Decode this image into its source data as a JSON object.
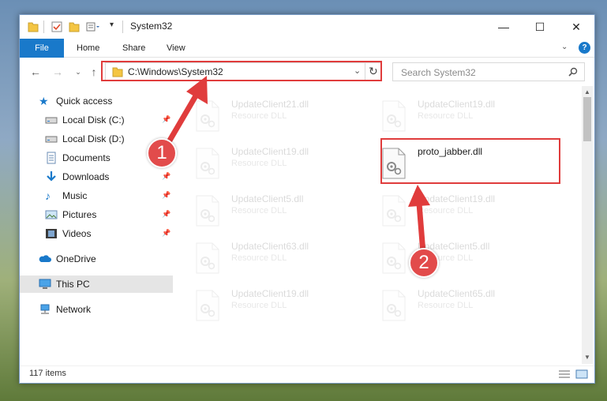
{
  "window": {
    "title": "System32",
    "controls": {
      "minimize": "—",
      "maximize": "☐",
      "close": "✕"
    }
  },
  "ribbon": {
    "tabs": [
      {
        "label": "File",
        "active": true
      },
      {
        "label": "Home"
      },
      {
        "label": "Share"
      },
      {
        "label": "View"
      }
    ]
  },
  "address": {
    "path": "C:\\Windows\\System32",
    "search_placeholder": "Search System32"
  },
  "sidebar": {
    "items": [
      {
        "label": "Quick access",
        "icon": "star-icon",
        "pinned": false
      },
      {
        "label": "Local Disk (C:)",
        "icon": "drive-icon",
        "pinned": true
      },
      {
        "label": "Local Disk (D:)",
        "icon": "drive-icon",
        "pinned": false
      },
      {
        "label": "Documents",
        "icon": "documents-icon",
        "pinned": true
      },
      {
        "label": "Downloads",
        "icon": "download-icon",
        "pinned": true
      },
      {
        "label": "Music",
        "icon": "music-icon",
        "pinned": true
      },
      {
        "label": "Pictures",
        "icon": "pictures-icon",
        "pinned": true
      },
      {
        "label": "Videos",
        "icon": "videos-icon",
        "pinned": true
      },
      {
        "label": "OneDrive",
        "icon": "cloud-icon",
        "pinned": false
      },
      {
        "label": "This PC",
        "icon": "computer-icon",
        "pinned": false
      },
      {
        "label": "Network",
        "icon": "network-icon",
        "pinned": false
      }
    ]
  },
  "files": [
    {
      "name": "UpdateClient21.dll",
      "type": "Resource DLL",
      "faded": true
    },
    {
      "name": "UpdateClient19.dll",
      "type": "Resource DLL",
      "faded": true
    },
    {
      "name": "UpdateClient19.dll",
      "type": "Resource DLL",
      "faded": true
    },
    {
      "name": "proto_jabber.dll",
      "type": "",
      "faded": false
    },
    {
      "name": "UpdateClient5.dll",
      "type": "Resource DLL",
      "faded": true
    },
    {
      "name": "UpdateClient19.dll",
      "type": "Resource DLL",
      "faded": true
    },
    {
      "name": "UpdateClient63.dll",
      "type": "Resource DLL",
      "faded": true
    },
    {
      "name": "UpdateClient5.dll",
      "type": "Resource DLL",
      "faded": true
    },
    {
      "name": "UpdateClient19.dll",
      "type": "Resource DLL",
      "faded": true
    },
    {
      "name": "UpdateClient65.dll",
      "type": "Resource DLL",
      "faded": true
    }
  ],
  "status": {
    "item_count": "117 items"
  },
  "annotations": {
    "step1": "1",
    "step2": "2",
    "highlight_color": "#e03c3c"
  },
  "colors": {
    "accent": "#1979ca",
    "selected": "#cce8ff",
    "help": "#1979ca"
  }
}
